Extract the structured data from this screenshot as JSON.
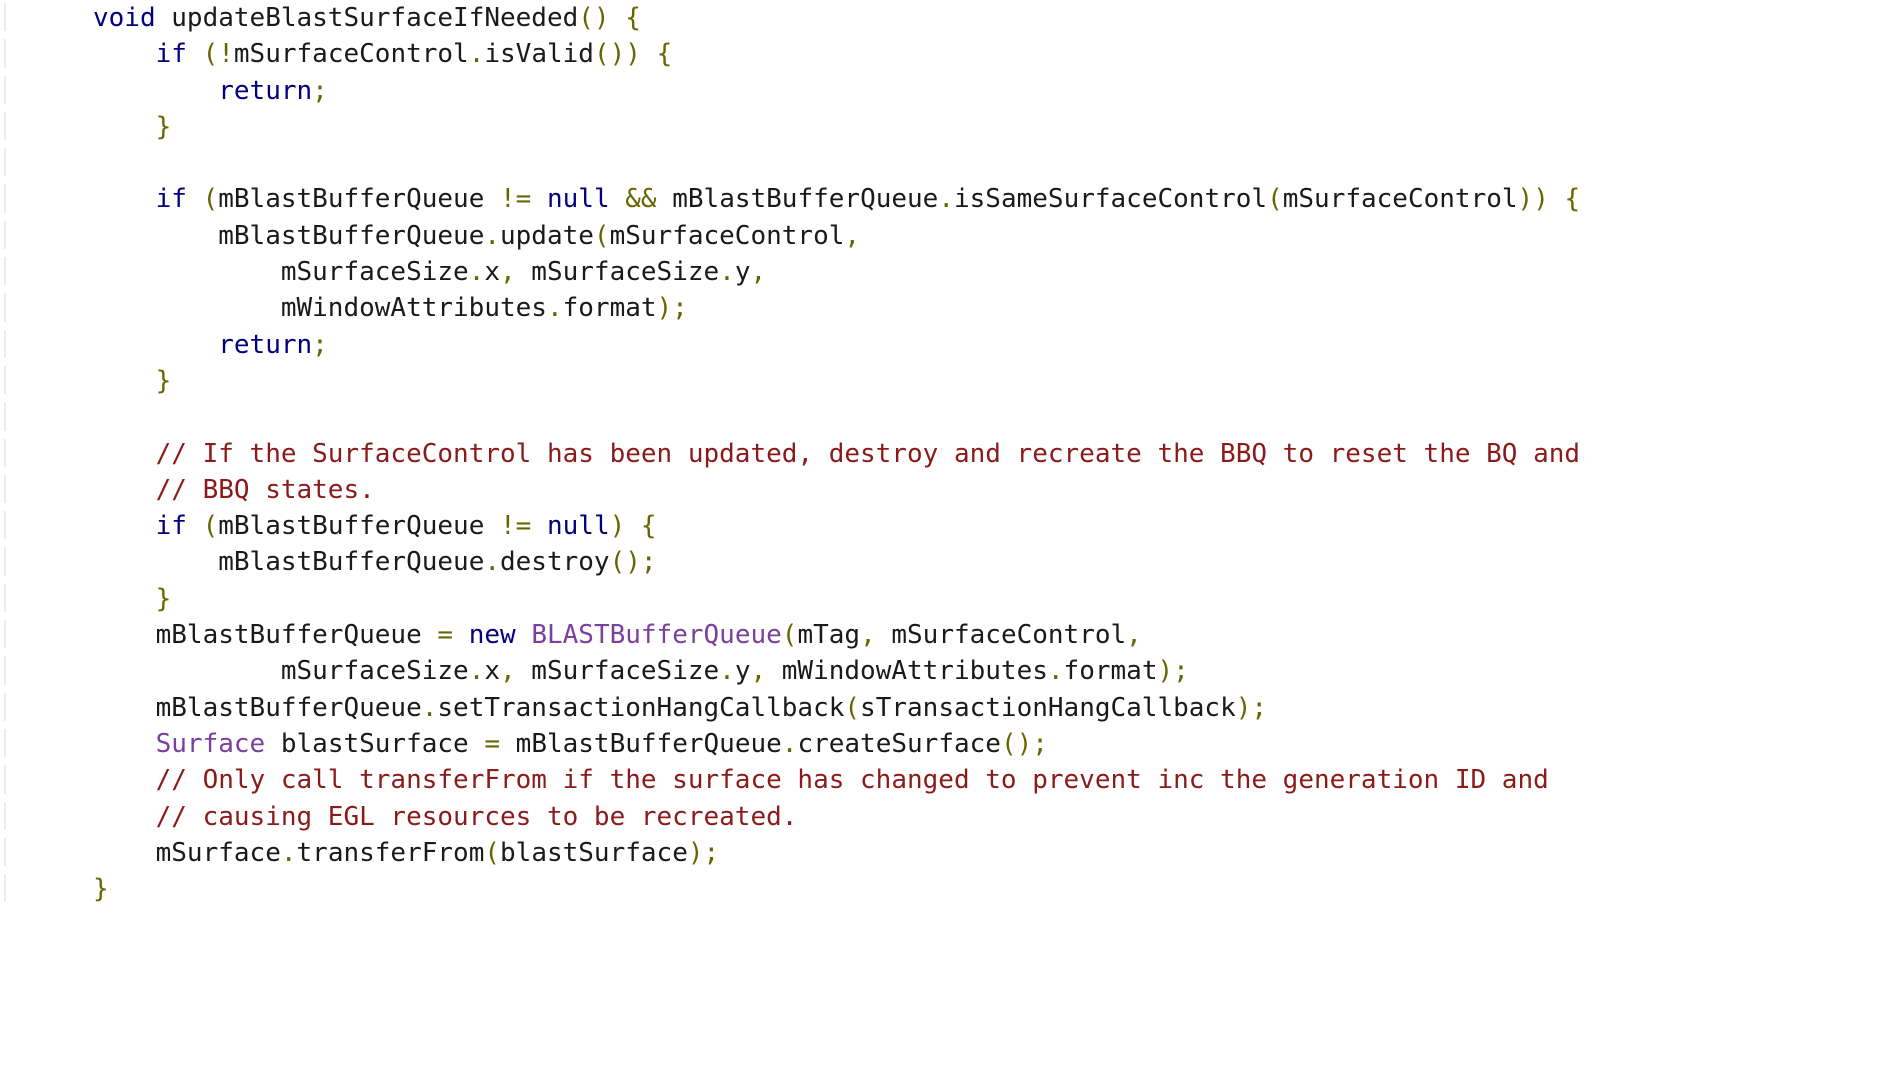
{
  "view": {
    "kind": "code-snippet",
    "language": "java",
    "background_color": "#ffffff",
    "gutter_rule_color": "#ececec"
  },
  "theme": {
    "keyword_color": "#000080",
    "type_color": "#7b3f9e",
    "punctuation_color": "#666600",
    "comment_color": "#8b1a1a",
    "plain_color": "#1a1a1a"
  },
  "code": {
    "lines": [
      {
        "indent": 1,
        "tokens": [
          {
            "t": "void",
            "c": "kw"
          },
          {
            "t": " updateBlastSurfaceIfNeeded",
            "c": "plain"
          },
          {
            "t": "() {",
            "c": "punct"
          }
        ]
      },
      {
        "indent": 2,
        "tokens": [
          {
            "t": "if",
            "c": "kw"
          },
          {
            "t": " ",
            "c": "plain"
          },
          {
            "t": "(!",
            "c": "punct"
          },
          {
            "t": "mSurfaceControl",
            "c": "plain"
          },
          {
            "t": ".",
            "c": "punct"
          },
          {
            "t": "isValid",
            "c": "plain"
          },
          {
            "t": "()) {",
            "c": "punct"
          }
        ]
      },
      {
        "indent": 3,
        "tokens": [
          {
            "t": "return",
            "c": "kw"
          },
          {
            "t": ";",
            "c": "punct"
          }
        ]
      },
      {
        "indent": 2,
        "tokens": [
          {
            "t": "}",
            "c": "punct"
          }
        ]
      },
      {
        "indent": 0,
        "tokens": []
      },
      {
        "indent": 2,
        "tokens": [
          {
            "t": "if",
            "c": "kw"
          },
          {
            "t": " ",
            "c": "plain"
          },
          {
            "t": "(",
            "c": "punct"
          },
          {
            "t": "mBlastBufferQueue",
            "c": "plain"
          },
          {
            "t": " ",
            "c": "plain"
          },
          {
            "t": "!=",
            "c": "punct"
          },
          {
            "t": " ",
            "c": "plain"
          },
          {
            "t": "null",
            "c": "kw"
          },
          {
            "t": " ",
            "c": "plain"
          },
          {
            "t": "&&",
            "c": "punct"
          },
          {
            "t": " mBlastBufferQueue",
            "c": "plain"
          },
          {
            "t": ".",
            "c": "punct"
          },
          {
            "t": "isSameSurfaceControl",
            "c": "plain"
          },
          {
            "t": "(",
            "c": "punct"
          },
          {
            "t": "mSurfaceControl",
            "c": "plain"
          },
          {
            "t": ")) {",
            "c": "punct"
          }
        ]
      },
      {
        "indent": 3,
        "tokens": [
          {
            "t": "mBlastBufferQueue",
            "c": "plain"
          },
          {
            "t": ".",
            "c": "punct"
          },
          {
            "t": "update",
            "c": "plain"
          },
          {
            "t": "(",
            "c": "punct"
          },
          {
            "t": "mSurfaceControl",
            "c": "plain"
          },
          {
            "t": ",",
            "c": "punct"
          }
        ]
      },
      {
        "indent": 4,
        "tokens": [
          {
            "t": "mSurfaceSize",
            "c": "plain"
          },
          {
            "t": ".",
            "c": "punct"
          },
          {
            "t": "x",
            "c": "plain"
          },
          {
            "t": ",",
            "c": "punct"
          },
          {
            "t": " mSurfaceSize",
            "c": "plain"
          },
          {
            "t": ".",
            "c": "punct"
          },
          {
            "t": "y",
            "c": "plain"
          },
          {
            "t": ",",
            "c": "punct"
          }
        ]
      },
      {
        "indent": 4,
        "tokens": [
          {
            "t": "mWindowAttributes",
            "c": "plain"
          },
          {
            "t": ".",
            "c": "punct"
          },
          {
            "t": "format",
            "c": "plain"
          },
          {
            "t": ");",
            "c": "punct"
          }
        ]
      },
      {
        "indent": 3,
        "tokens": [
          {
            "t": "return",
            "c": "kw"
          },
          {
            "t": ";",
            "c": "punct"
          }
        ]
      },
      {
        "indent": 2,
        "tokens": [
          {
            "t": "}",
            "c": "punct"
          }
        ]
      },
      {
        "indent": 0,
        "tokens": []
      },
      {
        "indent": 2,
        "tokens": [
          {
            "t": "// If the SurfaceControl has been updated, destroy and recreate the BBQ to reset the BQ and",
            "c": "comment"
          }
        ]
      },
      {
        "indent": 2,
        "tokens": [
          {
            "t": "// BBQ states.",
            "c": "comment"
          }
        ]
      },
      {
        "indent": 2,
        "tokens": [
          {
            "t": "if",
            "c": "kw"
          },
          {
            "t": " ",
            "c": "plain"
          },
          {
            "t": "(",
            "c": "punct"
          },
          {
            "t": "mBlastBufferQueue",
            "c": "plain"
          },
          {
            "t": " ",
            "c": "plain"
          },
          {
            "t": "!=",
            "c": "punct"
          },
          {
            "t": " ",
            "c": "plain"
          },
          {
            "t": "null",
            "c": "kw"
          },
          {
            "t": ") {",
            "c": "punct"
          }
        ]
      },
      {
        "indent": 3,
        "tokens": [
          {
            "t": "mBlastBufferQueue",
            "c": "plain"
          },
          {
            "t": ".",
            "c": "punct"
          },
          {
            "t": "destroy",
            "c": "plain"
          },
          {
            "t": "();",
            "c": "punct"
          }
        ]
      },
      {
        "indent": 2,
        "tokens": [
          {
            "t": "}",
            "c": "punct"
          }
        ]
      },
      {
        "indent": 2,
        "tokens": [
          {
            "t": "mBlastBufferQueue",
            "c": "plain"
          },
          {
            "t": " ",
            "c": "plain"
          },
          {
            "t": "=",
            "c": "punct"
          },
          {
            "t": " ",
            "c": "plain"
          },
          {
            "t": "new",
            "c": "kw"
          },
          {
            "t": " ",
            "c": "plain"
          },
          {
            "t": "BLASTBufferQueue",
            "c": "type"
          },
          {
            "t": "(",
            "c": "punct"
          },
          {
            "t": "mTag",
            "c": "plain"
          },
          {
            "t": ",",
            "c": "punct"
          },
          {
            "t": " mSurfaceControl",
            "c": "plain"
          },
          {
            "t": ",",
            "c": "punct"
          }
        ]
      },
      {
        "indent": 4,
        "tokens": [
          {
            "t": "mSurfaceSize",
            "c": "plain"
          },
          {
            "t": ".",
            "c": "punct"
          },
          {
            "t": "x",
            "c": "plain"
          },
          {
            "t": ",",
            "c": "punct"
          },
          {
            "t": " mSurfaceSize",
            "c": "plain"
          },
          {
            "t": ".",
            "c": "punct"
          },
          {
            "t": "y",
            "c": "plain"
          },
          {
            "t": ",",
            "c": "punct"
          },
          {
            "t": " mWindowAttributes",
            "c": "plain"
          },
          {
            "t": ".",
            "c": "punct"
          },
          {
            "t": "format",
            "c": "plain"
          },
          {
            "t": ");",
            "c": "punct"
          }
        ]
      },
      {
        "indent": 2,
        "tokens": [
          {
            "t": "mBlastBufferQueue",
            "c": "plain"
          },
          {
            "t": ".",
            "c": "punct"
          },
          {
            "t": "setTransactionHangCallback",
            "c": "plain"
          },
          {
            "t": "(",
            "c": "punct"
          },
          {
            "t": "sTransactionHangCallback",
            "c": "plain"
          },
          {
            "t": ");",
            "c": "punct"
          }
        ]
      },
      {
        "indent": 2,
        "tokens": [
          {
            "t": "Surface",
            "c": "type"
          },
          {
            "t": " blastSurface",
            "c": "plain"
          },
          {
            "t": " ",
            "c": "plain"
          },
          {
            "t": "=",
            "c": "punct"
          },
          {
            "t": " mBlastBufferQueue",
            "c": "plain"
          },
          {
            "t": ".",
            "c": "punct"
          },
          {
            "t": "createSurface",
            "c": "plain"
          },
          {
            "t": "();",
            "c": "punct"
          }
        ]
      },
      {
        "indent": 2,
        "tokens": [
          {
            "t": "// Only call transferFrom if the surface has changed to prevent inc the generation ID and",
            "c": "comment"
          }
        ]
      },
      {
        "indent": 2,
        "tokens": [
          {
            "t": "// causing EGL resources to be recreated.",
            "c": "comment"
          }
        ]
      },
      {
        "indent": 2,
        "tokens": [
          {
            "t": "mSurface",
            "c": "plain"
          },
          {
            "t": ".",
            "c": "punct"
          },
          {
            "t": "transferFrom",
            "c": "plain"
          },
          {
            "t": "(",
            "c": "punct"
          },
          {
            "t": "blastSurface",
            "c": "plain"
          },
          {
            "t": ");",
            "c": "punct"
          }
        ]
      },
      {
        "indent": 1,
        "tokens": [
          {
            "t": "}",
            "c": "punct"
          }
        ]
      }
    ]
  }
}
